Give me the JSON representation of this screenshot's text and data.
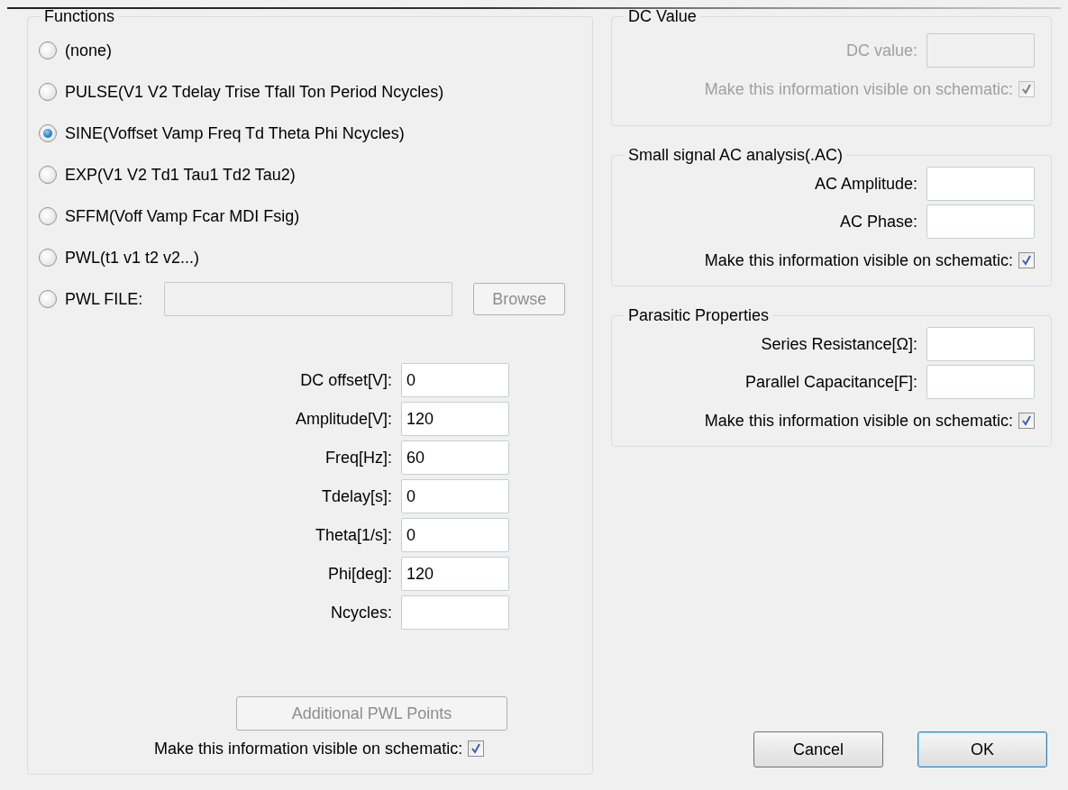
{
  "functions": {
    "title": "Functions",
    "options": [
      {
        "kind": "radio",
        "label": "(none)",
        "selected": false
      },
      {
        "kind": "radio",
        "label": "PULSE(V1 V2 Tdelay Trise Tfall Ton Period Ncycles)",
        "selected": false
      },
      {
        "kind": "radio",
        "label": "SINE(Voffset Vamp Freq Td Theta Phi Ncycles)",
        "selected": true
      },
      {
        "kind": "radio",
        "label": "EXP(V1 V2 Td1 Tau1 Td2 Tau2)",
        "selected": false
      },
      {
        "kind": "radio",
        "label": "SFFM(Voff Vamp Fcar MDI Fsig)",
        "selected": false
      },
      {
        "kind": "radio",
        "label": "PWL(t1 v1 t2 v2...)",
        "selected": false
      },
      {
        "kind": "file",
        "label": "PWL FILE:",
        "selected": false,
        "browse": "Browse",
        "disabled": true
      }
    ],
    "params": [
      {
        "label": "DC offset[V]:",
        "value": "0"
      },
      {
        "label": "Amplitude[V]:",
        "value": "120"
      },
      {
        "label": "Freq[Hz]:",
        "value": "60"
      },
      {
        "label": "Tdelay[s]:",
        "value": "0"
      },
      {
        "label": "Theta[1/s]:",
        "value": "0"
      },
      {
        "label": "Phi[deg]:",
        "value": "120"
      },
      {
        "label": "Ncycles:"
      }
    ],
    "additional_button": {
      "label": "Additional PWL Points",
      "disabled": true
    },
    "visible": {
      "label": "Make this information visible on schematic:",
      "checked": true,
      "disabled": false
    }
  },
  "groups": [
    {
      "title": "DC Value",
      "disabled": true,
      "fields": [
        {
          "label": "DC value:"
        }
      ],
      "visible": {
        "label": "Make this information visible on schematic:",
        "checked": true
      }
    },
    {
      "title": "Small signal AC analysis(.AC)",
      "disabled": false,
      "fields": [
        {
          "label": "AC Amplitude:"
        },
        {
          "label": "AC Phase:"
        }
      ],
      "visible": {
        "label": "Make this information visible on schematic:",
        "checked": true
      }
    },
    {
      "title": "Parasitic Properties",
      "disabled": false,
      "fields": [
        {
          "label": "Series Resistance[Ω]:"
        },
        {
          "label": "Parallel Capacitance[F]:"
        }
      ],
      "visible": {
        "label": "Make this information visible on schematic:",
        "checked": true
      }
    }
  ],
  "buttons": [
    {
      "label": "Cancel",
      "default": false
    },
    {
      "label": "OK",
      "default": true
    }
  ]
}
